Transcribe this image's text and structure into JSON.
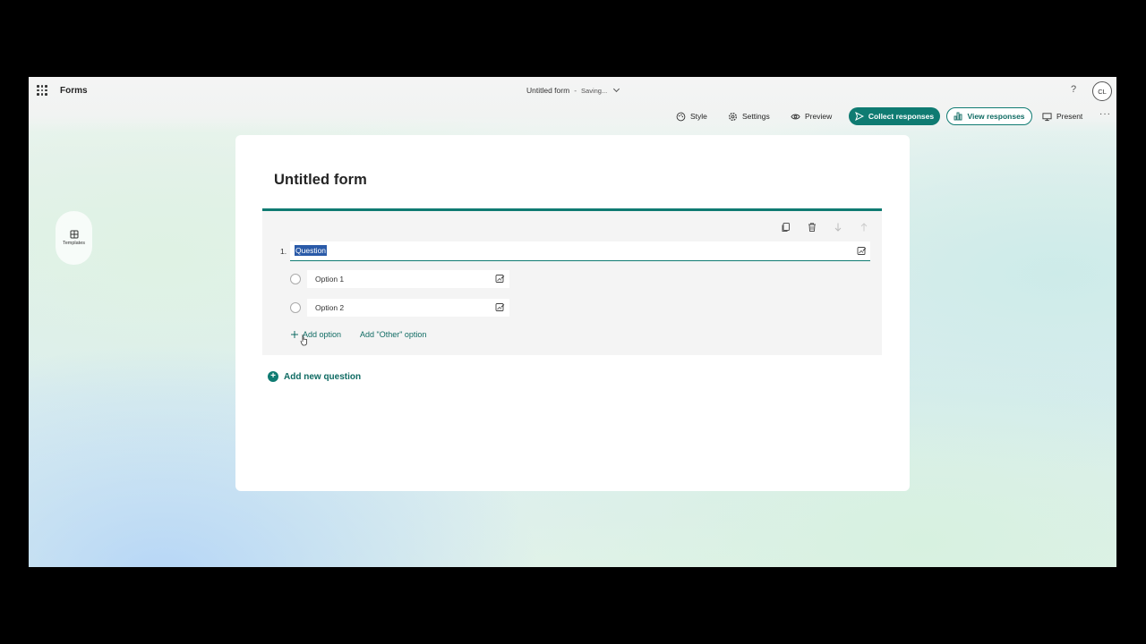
{
  "app": {
    "name": "Forms"
  },
  "document": {
    "title": "Untitled form",
    "separator": "-",
    "status": "Saving..."
  },
  "user": {
    "initials": "CL"
  },
  "help": {
    "glyph": "?"
  },
  "toolbar": {
    "style_label": "Style",
    "settings_label": "Settings",
    "preview_label": "Preview",
    "collect_label": "Collect responses",
    "view_label": "View responses",
    "present_label": "Present",
    "more_glyph": "···"
  },
  "sidebar": {
    "templates_label": "Templates"
  },
  "form": {
    "title": "Untitled form",
    "question": {
      "number": "1.",
      "text": "Question",
      "options": [
        {
          "label": "Option 1"
        },
        {
          "label": "Option 2"
        }
      ],
      "add_option_label": "Add option",
      "add_other_label": "Add \"Other\" option"
    },
    "add_question_label": "Add new question"
  },
  "colors": {
    "accent": "#0f7b72",
    "selection": "#2a5aa8"
  }
}
